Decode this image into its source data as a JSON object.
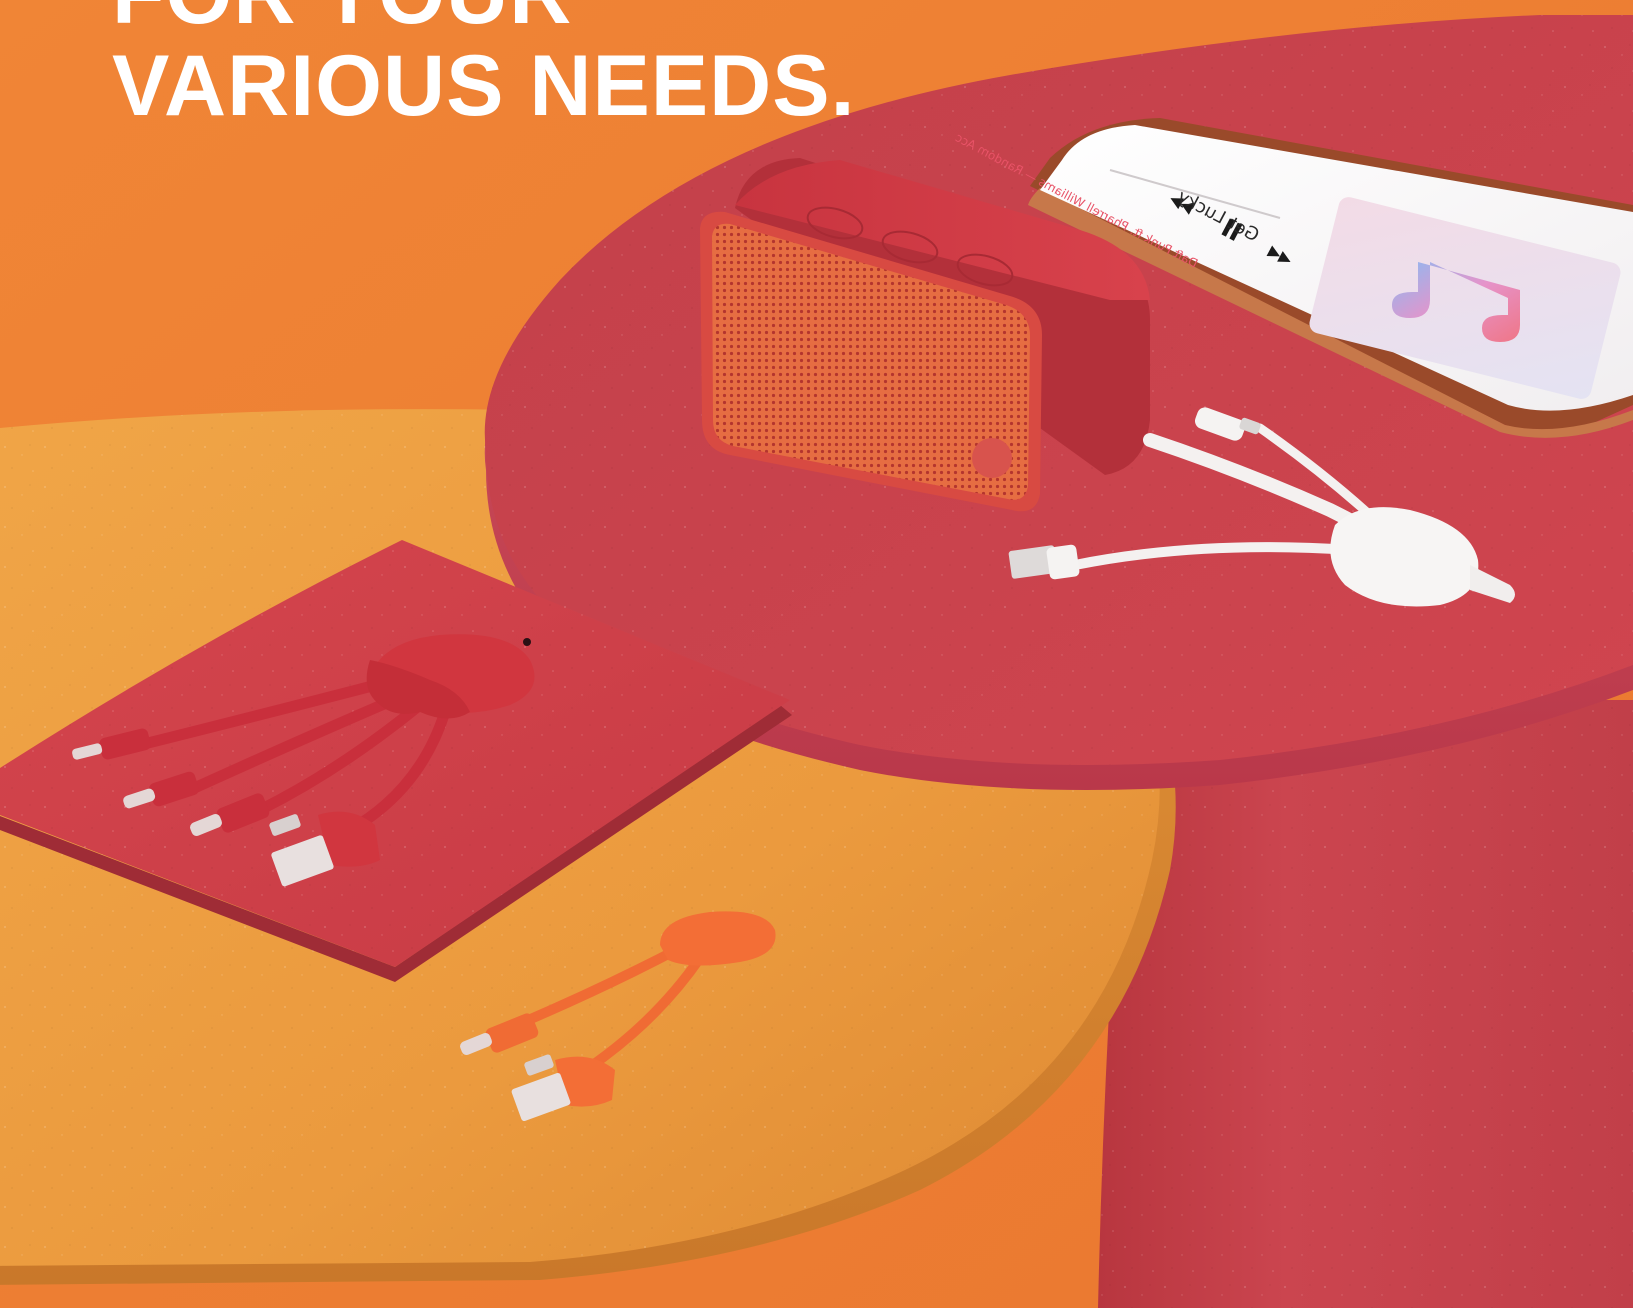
{
  "headline": {
    "line1": "FOR YOUR",
    "line2": "VARIOUS NEEDS."
  },
  "colors": {
    "background": "#ee7e33",
    "front_table": "#eb9d3f",
    "back_table": "#c9424b",
    "headline_text": "#ffffff"
  },
  "phone": {
    "song_title": "Get Lucky",
    "artist_line": "Daft Punk ft. Pharrell Williams — Random Acc"
  }
}
